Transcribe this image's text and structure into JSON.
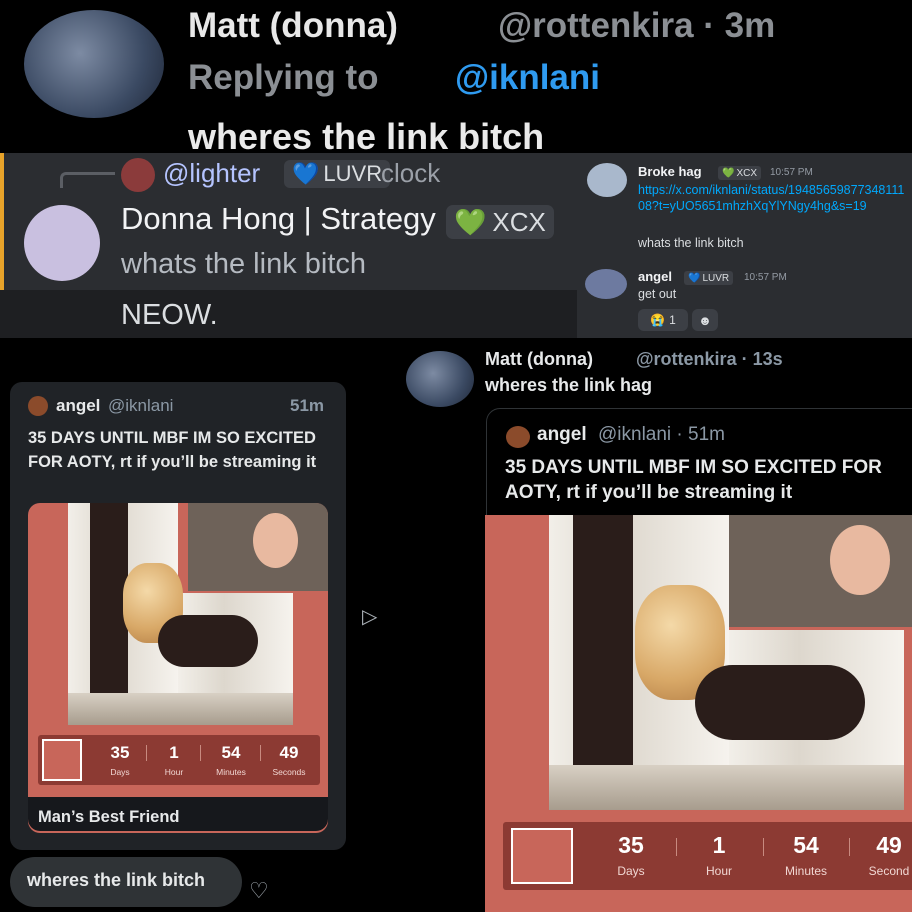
{
  "top_tweet": {
    "name": "Matt (donna)",
    "handle_time": "@rottenkira · 3m",
    "replying_label": "Replying to",
    "replying_to": "@iknlani",
    "text": "wheres the link bitch"
  },
  "discord_reply": {
    "ref_user": "@lighter",
    "ref_tag": "LUVR",
    "ref_text": "clock",
    "name": "Donna Hong | Strategy",
    "tag": "XCX",
    "message": "whats the link bitch",
    "next_message": "NEOW."
  },
  "discord_chat": {
    "msg1": {
      "name": "Broke hag",
      "tag": "XCX",
      "time": "10:57 PM",
      "link": "https://x.com/iknlani/status/1948565987734811108?t=yUO5651mhzhXqYlYNgy4hg&s=19",
      "text": "whats the link bitch"
    },
    "msg2": {
      "name": "angel",
      "tag": "LUVR",
      "time": "10:57 PM",
      "text": "get out",
      "reaction_emoji": "😭",
      "reaction_count": "1",
      "add_reaction": "☻"
    }
  },
  "dm_card": {
    "name": "angel",
    "handle": "@iknlani",
    "time": "51m",
    "text": "35 DAYS UNTIL MBF IM SO EXCITED FOR AOTY, rt if you’ll be streaming it",
    "countdown": [
      {
        "value": "35",
        "label": "Days"
      },
      {
        "value": "1",
        "label": "Hour"
      },
      {
        "value": "54",
        "label": "Minutes"
      },
      {
        "value": "49",
        "label": "Seconds"
      }
    ],
    "footer": "Man’s Best Friend",
    "reply_bubble": "wheres the link bitch"
  },
  "quote_tweet": {
    "name": "Matt (donna)",
    "handle_time": "@rottenkira · 13s",
    "text": "wheres the link hag",
    "quoted": {
      "name": "angel",
      "handle_time": "@iknlani · 51m",
      "text": "35 DAYS UNTIL MBF IM SO EXCITED FOR AOTY, rt if you’ll be streaming it",
      "countdown": [
        {
          "value": "35",
          "label": "Days"
        },
        {
          "value": "1",
          "label": "Hour"
        },
        {
          "value": "54",
          "label": "Minutes"
        },
        {
          "value": "49",
          "label": "Second"
        }
      ]
    }
  },
  "icons": {
    "heart": "♡",
    "send": "▷",
    "tag_heart": "💚",
    "tag_heart_blue": "💙"
  },
  "colors": {
    "link_blue": "#2f9bf0",
    "discord_bg": "#2b2d31",
    "album_red": "#c8665a"
  }
}
